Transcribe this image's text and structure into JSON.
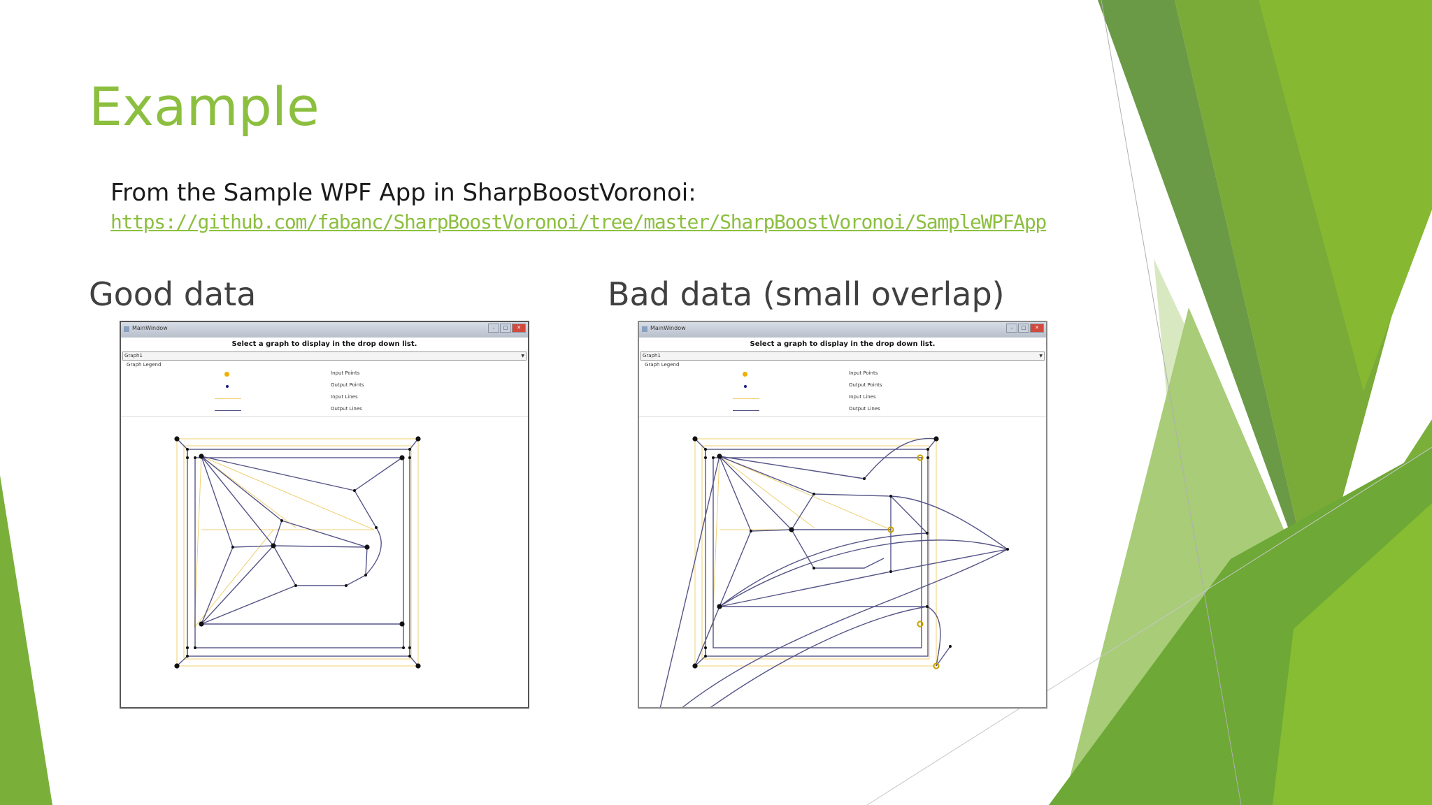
{
  "slide": {
    "title": "Example",
    "description": "From the Sample WPF App in SharpBoostVoronoi:",
    "link": "https://github.com/fabanc/SharpBoostVoronoi/tree/master/SharpBoostVoronoi/SampleWPFApp"
  },
  "panels": {
    "good": {
      "caption": "Good data",
      "window_title": "MainWindow",
      "header": "Select a graph to display in the drop down list.",
      "dropdown_value": "Graph1",
      "legend_title": "Graph Legend",
      "legend": {
        "input_points": "Input Points",
        "output_points": "Output Points",
        "input_lines": "Input Lines",
        "output_lines": "Output Lines"
      }
    },
    "bad": {
      "caption": "Bad data (small overlap)",
      "window_title": "MainWindow",
      "header": "Select a graph to display in the drop down list.",
      "dropdown_value": "Graph1",
      "legend_title": "Graph Legend",
      "legend": {
        "input_points": "Input Points",
        "output_points": "Output Points",
        "input_lines": "Input Lines",
        "output_lines": "Output Lines"
      }
    }
  },
  "colors": {
    "accent": "#8cbf3f",
    "input_lines": "#f0d070",
    "output_lines": "#555588",
    "input_points": "#f0b000"
  }
}
